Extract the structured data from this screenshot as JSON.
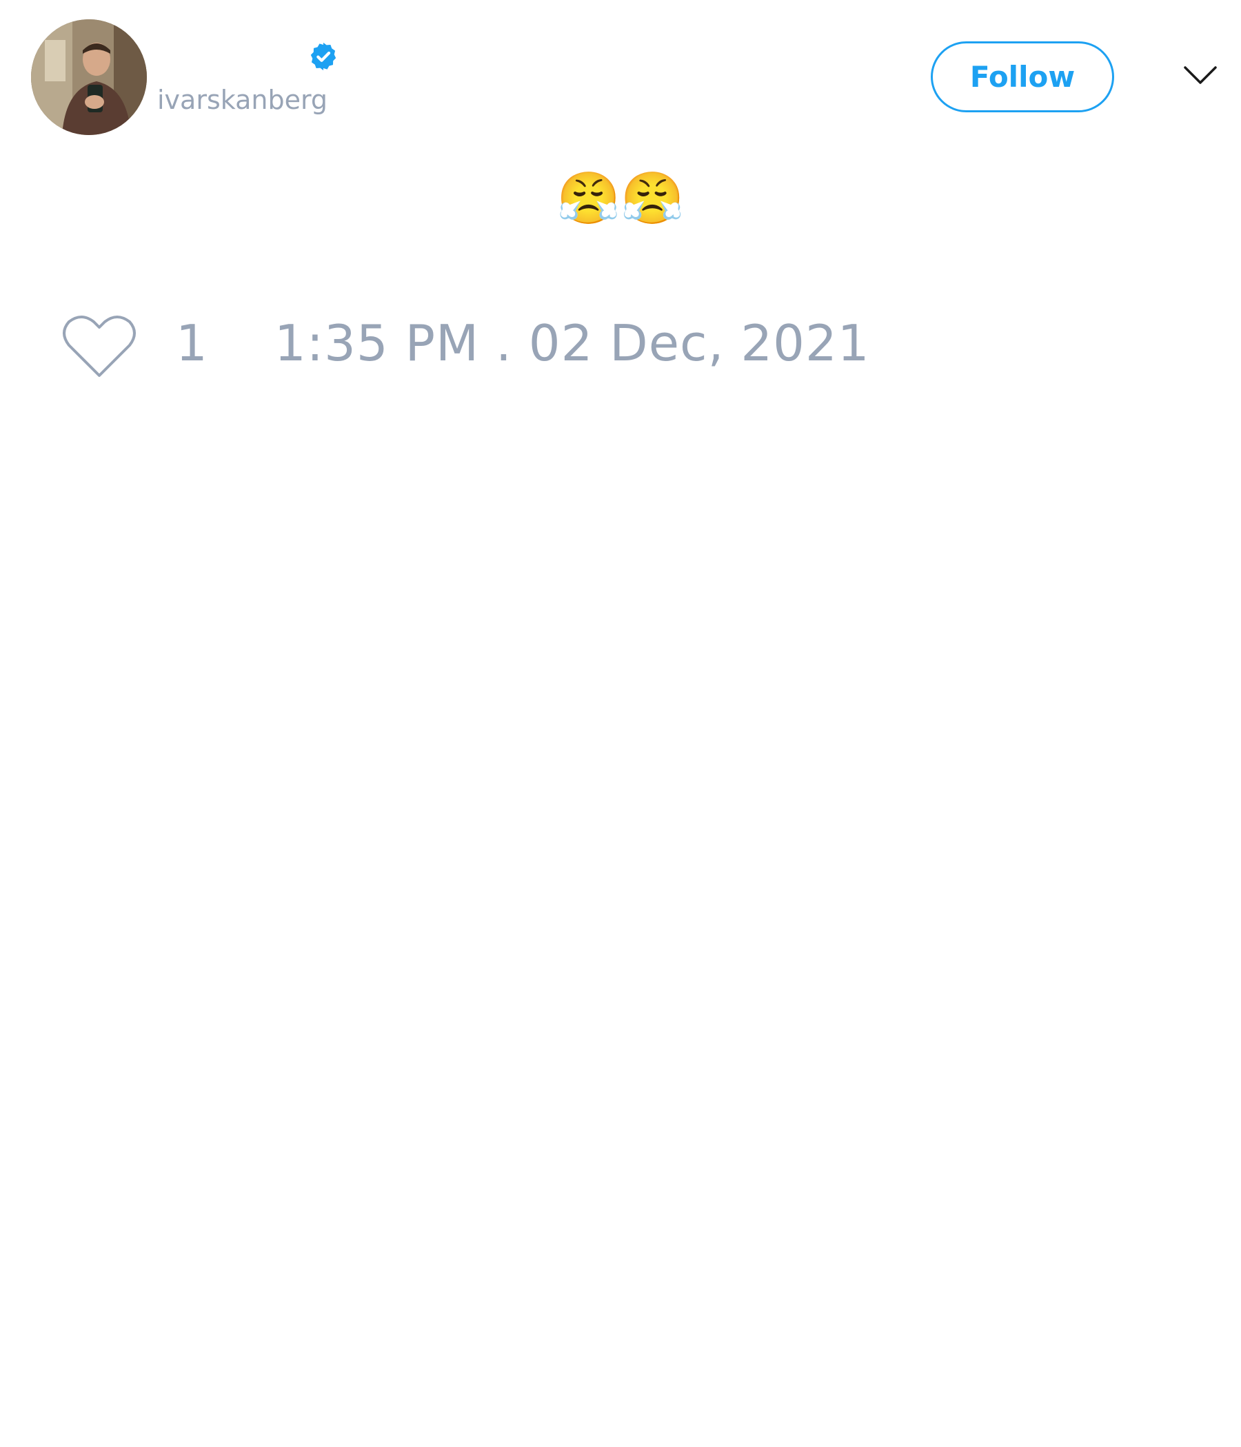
{
  "tweet": {
    "author": {
      "handle": "ivarskanberg",
      "verified": true,
      "avatar_alt": "profile photo"
    },
    "follow_label": "Follow",
    "text": "😤😤",
    "likes": "1",
    "timestamp": "1:35 PM . 02 Dec, 2021"
  },
  "icons": {
    "verified": "verified-badge-icon",
    "menu": "chevron-down-icon",
    "like": "heart-outline-icon"
  },
  "colors": {
    "accent": "#1da1f2",
    "muted": "#98a4b6",
    "background": "#ffffff"
  }
}
